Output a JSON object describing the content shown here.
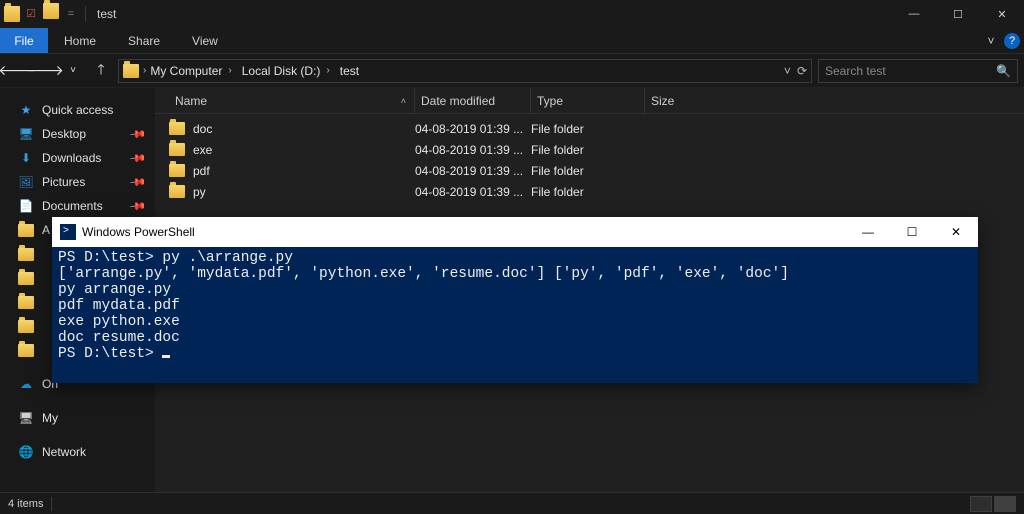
{
  "titlebar": {
    "title": "test",
    "qat_sep": "▾",
    "min": "—",
    "max": "☐",
    "close": "✕"
  },
  "ribbon": {
    "file": "File",
    "tabs": [
      "Home",
      "Share",
      "View"
    ],
    "expand": "˅",
    "help": "?"
  },
  "nav": {
    "crumbs": [
      "My Computer",
      "Local Disk (D:)",
      "test"
    ],
    "search_placeholder": "Search test",
    "back": "🡐",
    "fwd": "🡒",
    "dd": "˅",
    "up": "🡑",
    "refresh": "⟳",
    "drop": "˅"
  },
  "tree": {
    "quick": "Quick access",
    "desktop": "Desktop",
    "downloads": "Downloads",
    "pictures": "Pictures",
    "documents": "Documents",
    "a": "A",
    "onedrive": "On",
    "mypc": "My",
    "network": "Network"
  },
  "cols": {
    "name": "Name",
    "date": "Date modified",
    "type": "Type",
    "size": "Size"
  },
  "files": [
    {
      "name": "doc",
      "date": "04-08-2019 01:39 ...",
      "type": "File folder",
      "size": ""
    },
    {
      "name": "exe",
      "date": "04-08-2019 01:39 ...",
      "type": "File folder",
      "size": ""
    },
    {
      "name": "pdf",
      "date": "04-08-2019 01:39 ...",
      "type": "File folder",
      "size": ""
    },
    {
      "name": "py",
      "date": "04-08-2019 01:39 ...",
      "type": "File folder",
      "size": ""
    }
  ],
  "status": {
    "count": "4 items"
  },
  "powershell": {
    "title": "Windows PowerShell",
    "lines": [
      "PS D:\\test> py .\\arrange.py",
      "['arrange.py', 'mydata.pdf', 'python.exe', 'resume.doc'] ['py', 'pdf', 'exe', 'doc']",
      "py arrange.py",
      "pdf mydata.pdf",
      "exe python.exe",
      "doc resume.doc",
      "PS D:\\test> "
    ],
    "min": "—",
    "max": "☐",
    "close": "✕"
  }
}
